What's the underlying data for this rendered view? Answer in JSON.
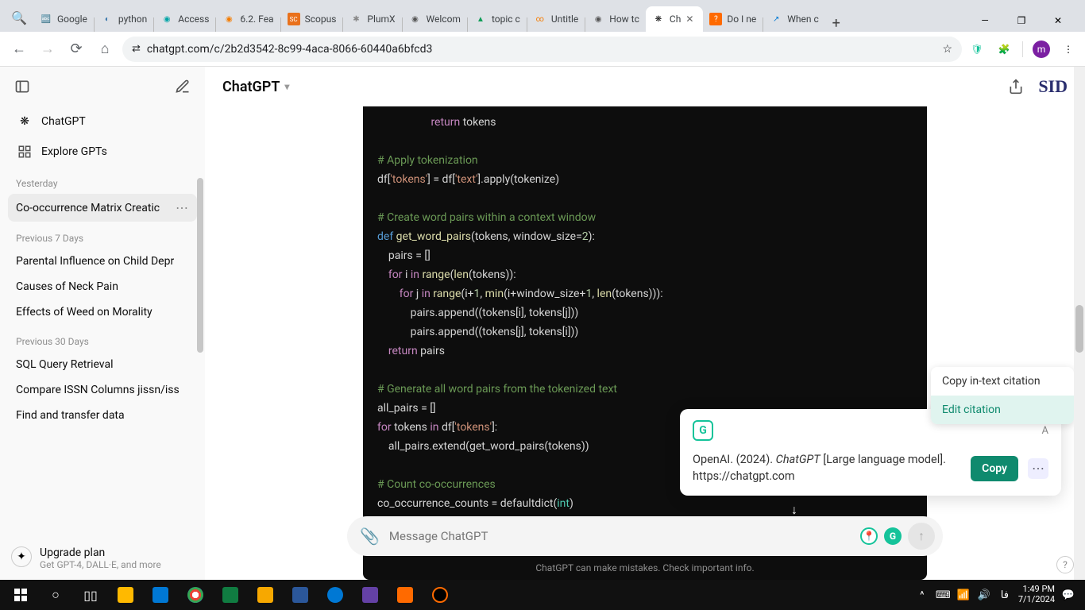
{
  "browser": {
    "tabs": [
      {
        "title": "Google",
        "color": "#4285f4",
        "letter": "G"
      },
      {
        "title": "python",
        "color": "#3776ab",
        "letter": "◐"
      },
      {
        "title": "Access",
        "color": "#00a4a6",
        "letter": "◉"
      },
      {
        "title": "6.2. Fea",
        "color": "#f57c00",
        "letter": "◉"
      },
      {
        "title": "Scopus",
        "color": "#e9711c",
        "letter": "SC"
      },
      {
        "title": "PlumX",
        "color": "#555",
        "letter": "✱"
      },
      {
        "title": "Welcom",
        "color": "#555",
        "letter": "◉"
      },
      {
        "title": "topic c",
        "color": "#0f9d58",
        "letter": "▲"
      },
      {
        "title": "Untitle",
        "color": "#f57c00",
        "letter": "∞"
      },
      {
        "title": "How tc",
        "color": "#555",
        "letter": "◉"
      },
      {
        "title": "Ch",
        "color": "#000",
        "letter": "❋",
        "active": true
      },
      {
        "title": "Do I ne",
        "color": "#ff6a00",
        "letter": "?"
      },
      {
        "title": "When c",
        "color": "#0078d4",
        "letter": "↗"
      }
    ],
    "url": "chatgpt.com/c/2b2d3542-8c99-4aca-8066-60440a6bfcd3"
  },
  "header": {
    "model": "ChatGPT",
    "brand": "SID"
  },
  "sidebar": {
    "chatgpt": "ChatGPT",
    "explore": "Explore GPTs",
    "sections": [
      {
        "head": "Yesterday",
        "items": [
          "Co-occurrence Matrix Creatic"
        ]
      },
      {
        "head": "Previous 7 Days",
        "items": [
          "Parental Influence on Child Depr",
          "Causes of Neck Pain",
          "Effects of Weed on Morality"
        ]
      },
      {
        "head": "Previous 30 Days",
        "items": [
          "SQL Query Retrieval",
          "Compare ISSN Columns jissn/iss",
          "Find and transfer data"
        ]
      }
    ],
    "upgrade": {
      "title": "Upgrade plan",
      "sub": "Get GPT-4, DALL·E, and more"
    }
  },
  "code": {
    "l1a": "return",
    "l1b": " tokens",
    "c1": "# Apply tokenization",
    "l2a": "df[",
    "l2b": "'tokens'",
    "l2c": "] = df[",
    "l2d": "'text'",
    "l2e": "].apply(tokenize)",
    "c2": "# Create word pairs within a context window",
    "l3a": "def ",
    "l3b": "get_word_pairs",
    "l3c": "(tokens, window_size=",
    "l3d": "2",
    "l3e": "):",
    "l4": "    pairs = []",
    "l5a": "    for",
    "l5b": " i ",
    "l5c": "in ",
    "l5d": "range",
    "l5e": "(",
    "l5f": "len",
    "l5g": "(tokens)):",
    "l6a": "        for",
    "l6b": " j ",
    "l6c": "in ",
    "l6d": "range",
    "l6e": "(i+",
    "l6f": "1",
    "l6g": ", ",
    "l6h": "min",
    "l6i": "(i+window_size+",
    "l6j": "1",
    "l6k": ", ",
    "l6l": "len",
    "l6m": "(tokens))):",
    "l7": "            pairs.append((tokens[i], tokens[j]))",
    "l8": "            pairs.append((tokens[j], tokens[i]))",
    "l9a": "    return",
    "l9b": " pairs",
    "c3": "# Generate all word pairs from the tokenized text",
    "l10": "all_pairs = []",
    "l11a": "for",
    "l11b": " tokens ",
    "l11c": "in",
    "l11d": " df[",
    "l11e": "'tokens'",
    "l11f": "]:",
    "l12": "    all_pairs.extend(get_word_pairs(tokens))",
    "c4": "# Count co-occurrences",
    "l13a": "co_occurrence_counts = defaultdict(",
    "l13b": "int",
    "l13c": ")"
  },
  "input": {
    "placeholder": "Message ChatGPT"
  },
  "footer": "ChatGPT can make mistakes. Check important info.",
  "citation": {
    "apa_label": "A",
    "text_a": "OpenAI. (2024). ",
    "text_i": "ChatGPT",
    "text_b": " [Large language model]. https://chatgpt.com",
    "copy": "Copy",
    "menu1": "Copy in-text citation",
    "menu2": "Edit citation"
  },
  "taskbar": {
    "time": "1:49 PM",
    "date": "7/1/2024",
    "lang": "فا"
  }
}
